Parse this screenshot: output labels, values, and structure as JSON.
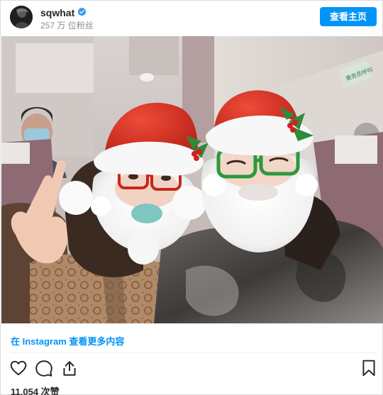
{
  "post": {
    "username": "sqwhat",
    "verified": true,
    "followers": "257 万 位粉丝",
    "view_profile_label": "查看主页",
    "photo_sign_text": "乘务员呼叫",
    "view_more_label": "在 Instagram 查看更多内容",
    "likes": "11,054 次赞"
  },
  "icons": {
    "avatar": "avatar-image",
    "verified": "verified-badge-icon",
    "like": "heart-icon",
    "comment": "comment-icon",
    "share": "share-icon",
    "save": "bookmark-icon"
  },
  "colors": {
    "accent": "#0095f6",
    "verified": "#3897f0",
    "santa_hat": "#d02a1e"
  }
}
